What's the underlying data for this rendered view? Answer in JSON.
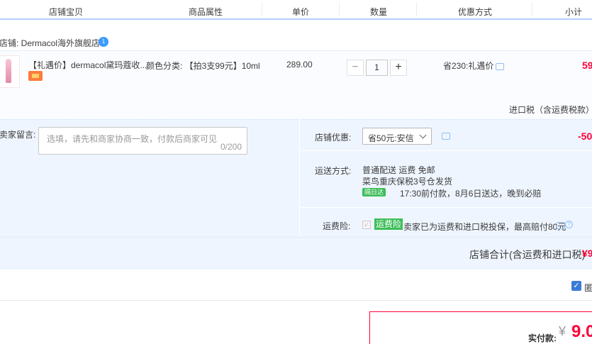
{
  "header": {
    "col_item": "店铺宝贝",
    "col_attr": "商品属性",
    "col_price": "单价",
    "col_qty": "数量",
    "col_discount": "优惠方式",
    "col_subtotal": "小计"
  },
  "shop": {
    "name_line": "店铺: Dermacol海外旗舰店",
    "badge": "1"
  },
  "item": {
    "name": "【礼遇价】dermacol黛玛蔻收...",
    "attr": "颜色分类: 【拍3支99元】10ml",
    "price": "289.00",
    "qty_minus": "−",
    "qty_value": "1",
    "qty_plus": "+",
    "discount": "省230:礼遇价",
    "subtotal": "59",
    "tax_note": "进口税（含运费税款）"
  },
  "message": {
    "label": "卖家留言:",
    "placeholder": "选填，请先和商家协商一致，付款后商家可见",
    "counter": "0/200"
  },
  "shop_discount": {
    "label": "店铺优惠:",
    "selected": "省50元:安信",
    "amount": "-50"
  },
  "shipping": {
    "label": "运送方式:",
    "line1": "普通配送 运费 免邮",
    "line2": "菜鸟重庆保税3号仓",
    "line2b": "发货",
    "tag": "隔日达",
    "line3": "17:30前付款，8月6日送达，晚到必赔"
  },
  "insurance": {
    "label": "运费险:",
    "check": "✓",
    "tag": "运费险",
    "text": "卖家已为运费和进口税投保，最高赔付80元"
  },
  "shop_total": {
    "label": "店铺合计(含运费和进口税)",
    "value": "¥9"
  },
  "checkbox": {
    "mark": "✓",
    "label": "匿"
  },
  "pay": {
    "label": "实付款:",
    "currency": "¥",
    "value": "9.0"
  },
  "colors": {
    "accent_red": "#ff0036",
    "header_border": "#b2d1ff",
    "panel_bg": "#eff5ff",
    "tag_green": "#3cbd57"
  }
}
